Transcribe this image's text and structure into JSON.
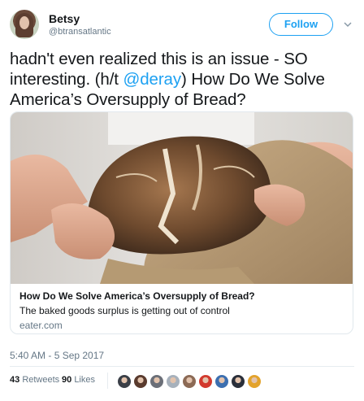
{
  "author": {
    "name": "Betsy",
    "handle": "@btransatlantic"
  },
  "follow_label": "Follow",
  "tweet": {
    "text_before": "hadn't even realized this is an issue - SO interesting. (h/t ",
    "mention": "@deray",
    "text_after": ") How Do We Solve America’s Oversupply of Bread?"
  },
  "card": {
    "title": "How Do We Solve America’s Oversupply of Bread?",
    "description": "The baked goods surplus is getting out of control",
    "domain": "eater.com"
  },
  "timestamp": "5:40 AM - 5 Sep 2017",
  "stats": {
    "retweets_count": "43",
    "retweets_label": "Retweets",
    "likes_count": "90",
    "likes_label": "Likes"
  },
  "likers": [
    "#3a3f47",
    "#5a3b2e",
    "#6b6f78",
    "#a7b1bc",
    "#8c6a55",
    "#d23a2e",
    "#3c6fb0",
    "#2a2f3a",
    "#e3a32c"
  ],
  "colors": {
    "accent": "#1da1f2",
    "text": "#14171a",
    "muted": "#657786",
    "border": "#e1e8ed"
  }
}
